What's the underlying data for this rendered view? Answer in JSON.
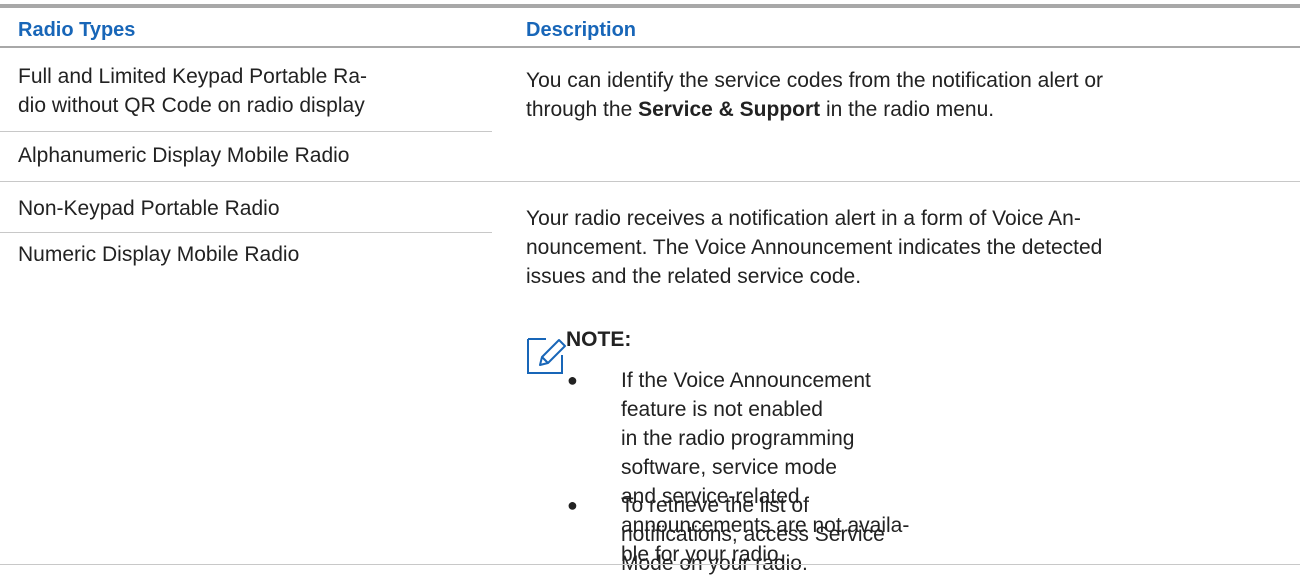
{
  "header": {
    "col1": "Radio Types",
    "col2": "Description"
  },
  "rows": [
    {
      "types": [
        "Full and Limited Keypad Portable Ra-",
        "dio without QR Code on radio display"
      ],
      "type2": "Alphanumeric Display Mobile Radio",
      "desc_line1": "You can identify the service codes from the notification alert or",
      "desc_line2_pre": "through the ",
      "desc_line2_bold": "Service & Support",
      "desc_line2_post": " in the radio menu."
    },
    {
      "type1": "Non-Keypad Portable Radio",
      "type2": "Numeric Display Mobile Radio",
      "desc_lines": [
        "Your radio receives a notification alert in a form of Voice An-",
        "nouncement. The Voice Announcement indicates the detected",
        "issues and the related service code."
      ],
      "note_title": "NOTE:",
      "note_bullets": [
        [
          "If the Voice Announcement feature is not enabled",
          "in the radio programming software, service mode",
          "and service-related announcements are not availa-",
          "ble for your radio."
        ],
        [
          "To retrieve the list of notifications, access Service",
          "Mode on your radio."
        ]
      ]
    }
  ],
  "icons": {
    "note": "note-pencil-icon",
    "bullet": "bullet-dot"
  },
  "colors": {
    "header_text": "#1866b8",
    "icon": "#1866b8"
  }
}
